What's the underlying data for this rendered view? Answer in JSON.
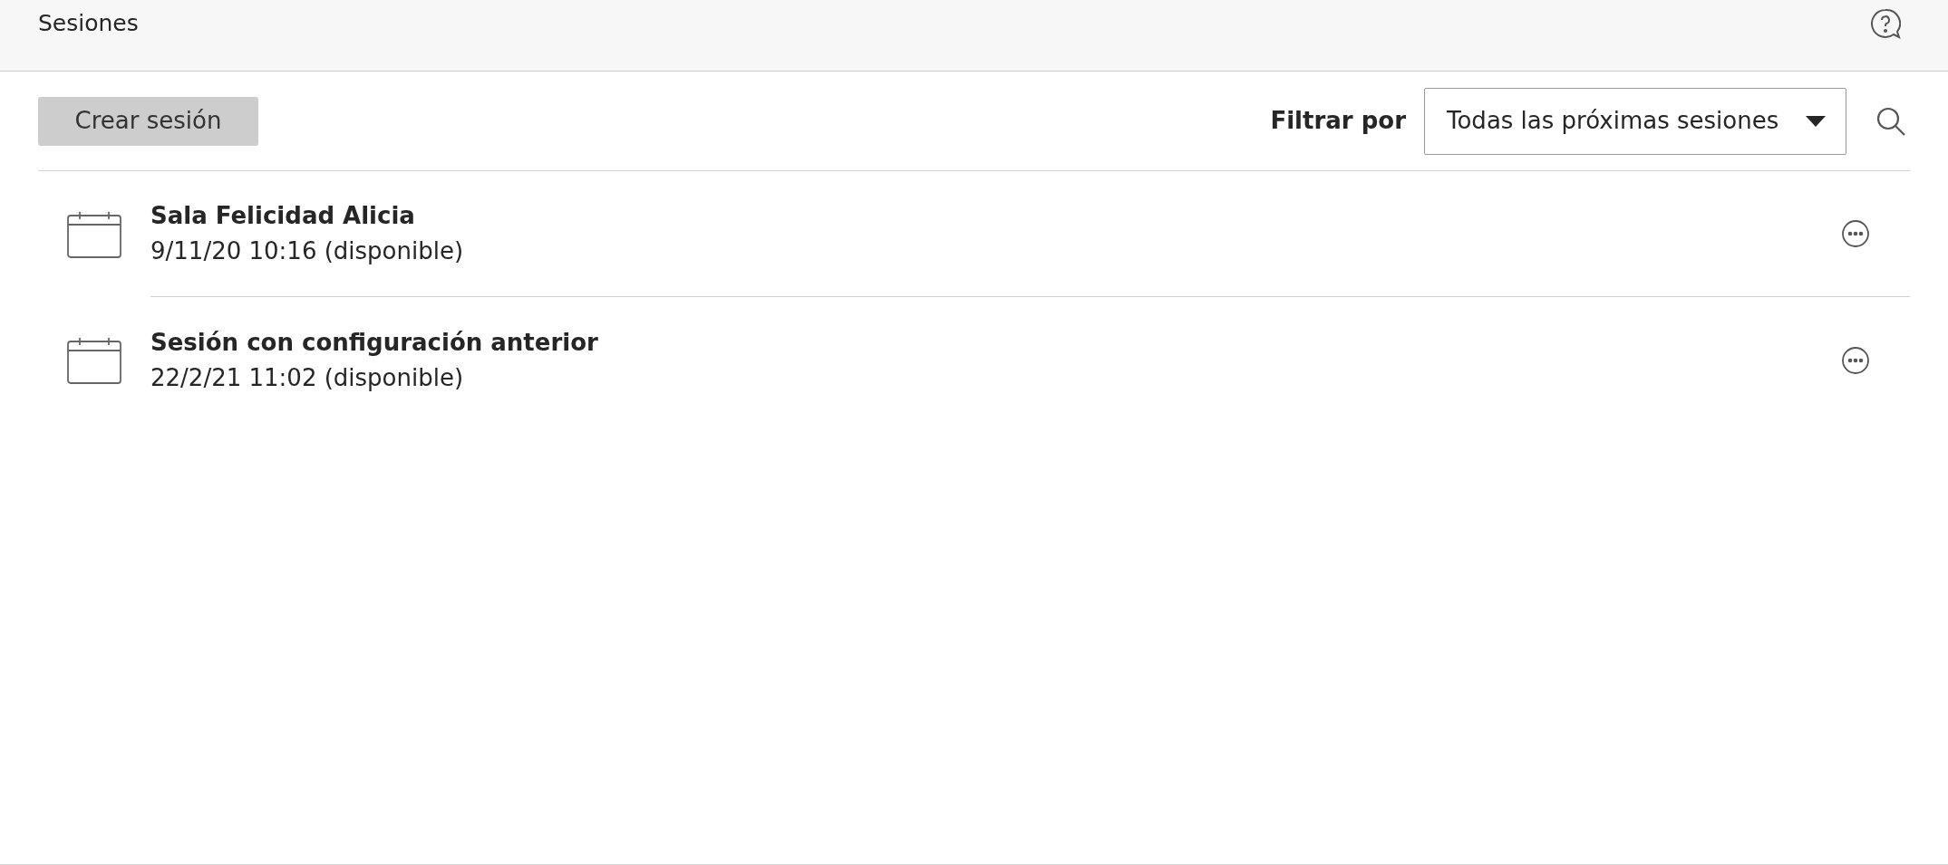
{
  "header": {
    "title": "Sesiones"
  },
  "toolbar": {
    "create_button": "Crear sesión",
    "filter_label": "Filtrar por",
    "filter_value": "Todas las próximas sesiones"
  },
  "sessions": [
    {
      "name": "Sala Felicidad Alicia",
      "date": "9/11/20 10:16 (disponible)"
    },
    {
      "name": "Sesión con configuración anterior",
      "date": "22/2/21 11:02 (disponible)"
    }
  ]
}
